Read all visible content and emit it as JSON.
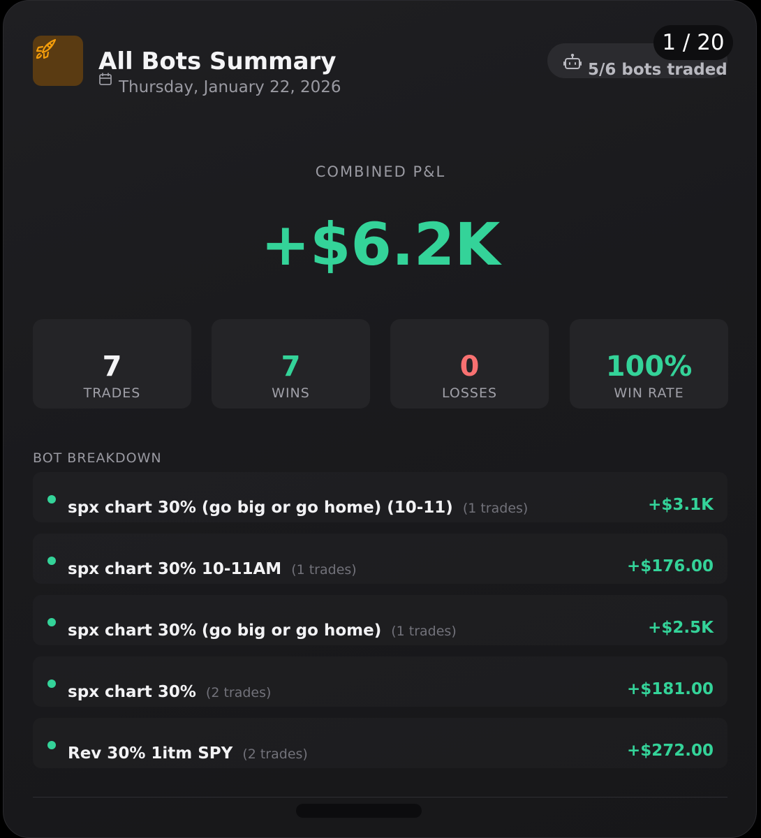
{
  "header": {
    "title": "All Bots Summary",
    "date": "Thursday, January 22, 2026",
    "bots_traded": "5/6 bots traded",
    "page_counter": "1 / 20"
  },
  "pnl": {
    "label": "COMBINED P&L",
    "value": "+$6.2K"
  },
  "stats": [
    {
      "value": "7",
      "label": "TRADES"
    },
    {
      "value": "7",
      "label": "WINS"
    },
    {
      "value": "0",
      "label": "LOSSES"
    },
    {
      "value": "100%",
      "label": "WIN RATE"
    }
  ],
  "breakdown": {
    "title": "BOT BREAKDOWN",
    "bots": [
      {
        "name": "spx chart 30% (go big or go home) (10-11)",
        "trades": "(1 trades)",
        "pnl": "+$3.1K"
      },
      {
        "name": "spx chart 30% 10-11AM",
        "trades": "(1 trades)",
        "pnl": "+$176.00"
      },
      {
        "name": "spx chart 30% (go big or go home)",
        "trades": "(1 trades)",
        "pnl": "+$2.5K"
      },
      {
        "name": "spx chart 30%",
        "trades": "(2 trades)",
        "pnl": "+$181.00"
      },
      {
        "name": "Rev 30% 1itm SPY",
        "trades": "(2 trades)",
        "pnl": "+$272.00"
      }
    ]
  },
  "colors": {
    "positive": "#34d399",
    "negative": "#f87171",
    "neutral": "#f4f4f6",
    "icon_accent": "#f59e0b"
  },
  "icons": {
    "app": "rocket-icon",
    "date": "calendar-icon",
    "bots": "robot-icon",
    "status": "status-dot-icon"
  }
}
